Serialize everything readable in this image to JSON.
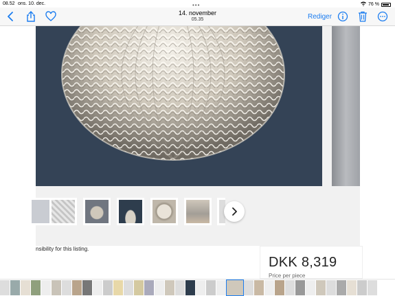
{
  "status": {
    "time": "08.52",
    "date": "ons. 10. dec.",
    "battery": "76 %"
  },
  "toolbar": {
    "title": "14. november",
    "subtitle": "05.35",
    "edit_label": "Rediger",
    "accent": "#1a7cf0"
  },
  "listing": {
    "responsibility_text": "nsibility for this listing.",
    "price": "DKK 8,319",
    "price_caption": "Price per piece"
  },
  "thumbnails": [
    {
      "icon": "lamp-thumb-1",
      "bg": "#c9ccd2"
    },
    {
      "icon": "lamp-thumb-2",
      "bg": "#d9d9d9"
    },
    {
      "icon": "lamp-thumb-3",
      "bg": "#8a8f96"
    },
    {
      "icon": "lamp-thumb-4",
      "bg": "#2e3d4d"
    },
    {
      "icon": "lamp-thumb-5",
      "bg": "#b7b0a7"
    },
    {
      "icon": "lamp-thumb-6",
      "bg": "#a39e97"
    }
  ]
}
